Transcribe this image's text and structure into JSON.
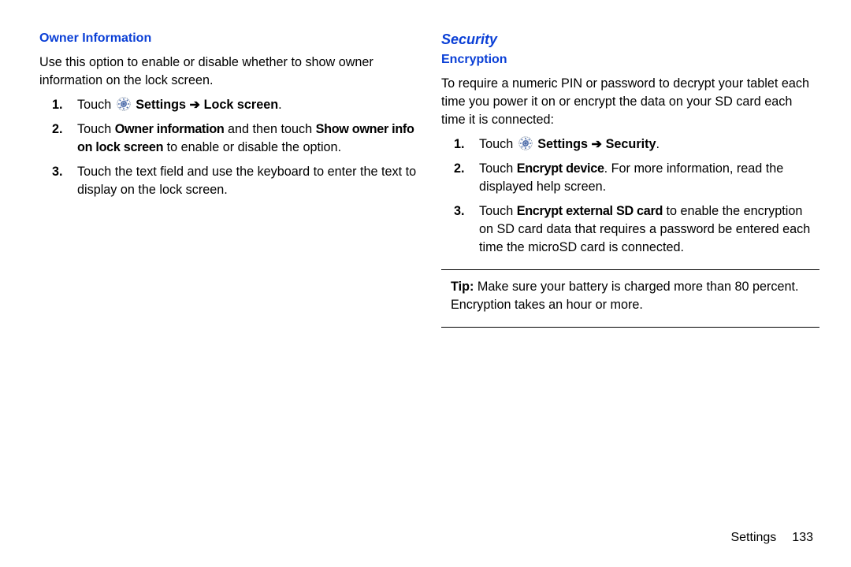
{
  "left": {
    "heading": "Owner Information",
    "intro": "Use this option to enable or disable whether to show owner information on the lock screen.",
    "s1a": "Touch ",
    "s1b": "Settings",
    "s1c": "Lock screen",
    "s1d": ".",
    "s2a": "Touch ",
    "s2b": "Owner information",
    "s2c": " and then touch ",
    "s2d": "Show owner info on lock screen",
    "s2e": " to enable or disable the option.",
    "s3": "Touch the text field and use the keyboard to enter the text to display on the lock screen."
  },
  "right": {
    "section": "Security",
    "sub": "Encryption",
    "intro": "To require a numeric PIN or password to decrypt your tablet each time you power it on or encrypt the data on your SD card each time it is connected:",
    "s1a": "Touch ",
    "s1b": "Settings",
    "s1c": "Security",
    "s1d": ".",
    "s2a": "Touch ",
    "s2b": "Encrypt device",
    "s2c": ". For more information, read the displayed help screen.",
    "s3a": "Touch ",
    "s3b": "Encrypt external SD card",
    "s3c": " to enable the encryption on SD card data that requires a password be entered each time the microSD card is connected.",
    "tipLabel": "Tip:",
    "tipText": " Make sure your battery is charged more than 80 percent. Encryption takes an hour or more."
  },
  "footer": {
    "section": "Settings",
    "page": "133"
  }
}
